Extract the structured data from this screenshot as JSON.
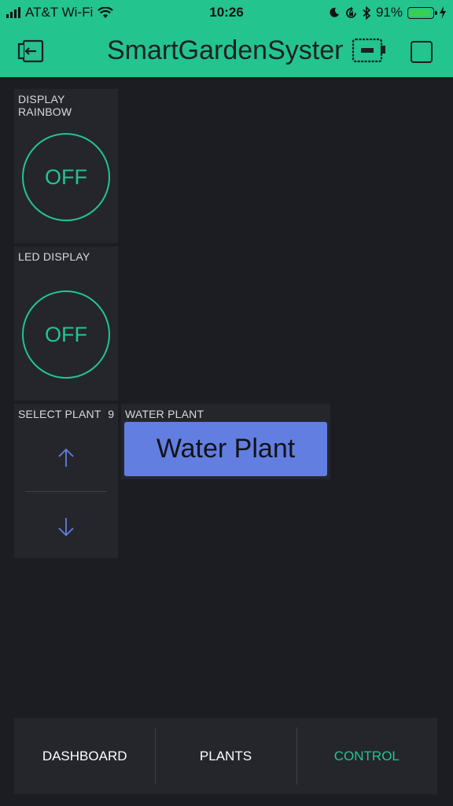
{
  "status_bar": {
    "carrier": "AT&T Wi-Fi",
    "time": "10:26",
    "battery": "91%"
  },
  "header": {
    "title": "SmartGardenSystem",
    "icons": [
      "back-arrow-icon",
      "device-icon",
      "square-icon"
    ]
  },
  "widgets": {
    "display_rainbow": {
      "label": "DISPLAY RAINBOW",
      "state": "OFF"
    },
    "led_display": {
      "label": "LED DISPLAY",
      "state": "OFF"
    },
    "select_plant": {
      "label": "SELECT PLANT",
      "value": "9"
    },
    "water_plant": {
      "label": "WATER PLANT",
      "button": "Water Plant"
    }
  },
  "tabs": [
    {
      "label": "DASHBOARD",
      "active": false
    },
    {
      "label": "PLANTS",
      "active": false
    },
    {
      "label": "CONTROL",
      "active": true
    }
  ],
  "colors": {
    "accent": "#23c48e",
    "background": "#1c1d22",
    "widget": "#24262c",
    "button": "#627ee0"
  }
}
